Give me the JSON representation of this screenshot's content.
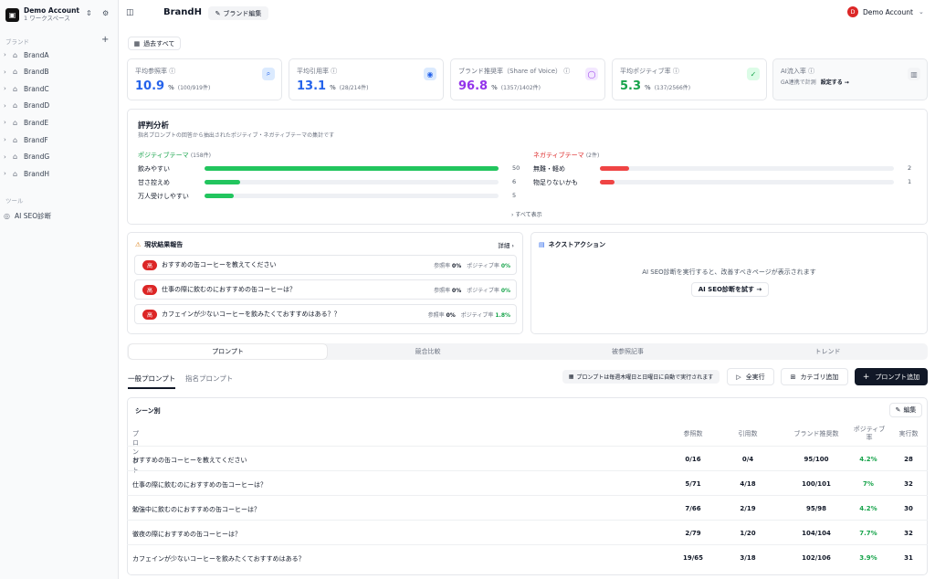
{
  "sidebar": {
    "account_name": "Demo Account",
    "workspace": "1 ワークスペース",
    "brands_heading": "ブランド",
    "brands": [
      "BrandA",
      "BrandB",
      "BrandC",
      "BrandD",
      "BrandE",
      "BrandF",
      "BrandG",
      "BrandH"
    ],
    "tools_heading": "ツール",
    "tool_item": "AI SEO診断"
  },
  "header": {
    "brand": "BrandH",
    "edit_label": "ブランド編集",
    "user_initial": "D",
    "user_name": "Demo Account"
  },
  "period": "過去すべて",
  "metrics": [
    {
      "label": "平均参照率",
      "value": "10.9",
      "unit": "%",
      "sub": "(100/919件)",
      "color": "#2563eb",
      "icon": "search-icon",
      "glyph": "⌕",
      "bg": "#dbeafe"
    },
    {
      "label": "平均引用率",
      "value": "13.1",
      "unit": "%",
      "sub": "(28/214件)",
      "color": "#2563eb",
      "icon": "eye-icon",
      "glyph": "◉",
      "bg": "#dbeafe"
    },
    {
      "label": "ブランド推奨率（Share of Voice）",
      "value": "96.8",
      "unit": "%",
      "sub": "(1357/1402件)",
      "color": "#9333ea",
      "icon": "chat-icon",
      "glyph": "◯",
      "bg": "#f3e8ff"
    },
    {
      "label": "平均ポジティブ率",
      "value": "5.3",
      "unit": "%",
      "sub": "(137/2566件)",
      "color": "#16a34a",
      "icon": "thumbs-up-icon",
      "glyph": "✓",
      "bg": "#dcfce7"
    }
  ],
  "ai_flow": {
    "label": "AI流入率",
    "note": "GA連携で計測",
    "link": "設定する →"
  },
  "reputation": {
    "title": "評判分析",
    "subtitle": "指名プロンプトの回答から抽出されたポジティブ・ネガティブテーマの集計です",
    "positive_heading": "ポジティブテーマ",
    "positive_count": "(158件)",
    "negative_heading": "ネガティブテーマ",
    "negative_count": "(2件)",
    "positive": [
      {
        "label": "飲みやすい",
        "count": 50
      },
      {
        "label": "甘さ控えめ",
        "count": 6
      },
      {
        "label": "万人受けしやすい",
        "count": 5
      }
    ],
    "negative": [
      {
        "label": "無難・軽め",
        "count": 2
      },
      {
        "label": "物足りないかも",
        "count": 1
      }
    ],
    "show_all": "すべて表示"
  },
  "status_report": {
    "title": "現状結果報告",
    "detail": "詳細",
    "tag": "高",
    "ref_label": "参照率",
    "pos_label": "ポジティブ率",
    "rows": [
      {
        "q": "おすすめの缶コーヒーを教えてください",
        "ref": "0%",
        "pos": "0%"
      },
      {
        "q": "仕事の際に飲むのにおすすめの缶コーヒーは？",
        "ref": "0%",
        "pos": "0%"
      },
      {
        "q": "カフェインが少ないコーヒーを飲みたくておすすめはある？？",
        "ref": "0%",
        "pos": "1.8%"
      }
    ]
  },
  "next_action": {
    "title": "ネクストアクション",
    "message": "AI SEO診断を実行すると、改善すべきページが表示されます",
    "button": "AI SEO診断を試す →"
  },
  "tabs": [
    "プロンプト",
    "競合比較",
    "被参照記事",
    "トレンド"
  ],
  "subtabs": [
    "一般プロンプト",
    "指名プロンプト"
  ],
  "schedule_note": "プロンプトは毎週木曜日と日曜日に自動で実行されます",
  "buttons": {
    "run_all": "全実行",
    "category_add": "カテゴリ追加",
    "prompt_add": "プロンプト追加",
    "edit": "編集"
  },
  "table": {
    "section": "シーン別",
    "headers": [
      "プロンプト",
      "参照数",
      "引用数",
      "ブランド推奨数",
      "ポジティブ率",
      "実行数"
    ],
    "rows": [
      {
        "prompt": "おすすめの缶コーヒーを教えてください",
        "ref": "0/16",
        "cite": "0/4",
        "rec": "95/100",
        "pos": "4.2%",
        "runs": "28"
      },
      {
        "prompt": "仕事の際に飲むのにおすすめの缶コーヒーは？",
        "ref": "5/71",
        "cite": "4/18",
        "rec": "100/101",
        "pos": "7%",
        "runs": "32"
      },
      {
        "prompt": "勉強中に飲むのにおすすめの缶コーヒーは？",
        "ref": "7/66",
        "cite": "2/19",
        "rec": "95/98",
        "pos": "4.2%",
        "runs": "30"
      },
      {
        "prompt": "徹夜の際におすすめの缶コーヒーは？",
        "ref": "2/79",
        "cite": "1/20",
        "rec": "104/104",
        "pos": "7.7%",
        "runs": "32"
      },
      {
        "prompt": "カフェインが少ないコーヒーを飲みたくておすすめはある？",
        "ref": "19/65",
        "cite": "3/18",
        "rec": "102/106",
        "pos": "3.9%",
        "runs": "31"
      }
    ]
  }
}
